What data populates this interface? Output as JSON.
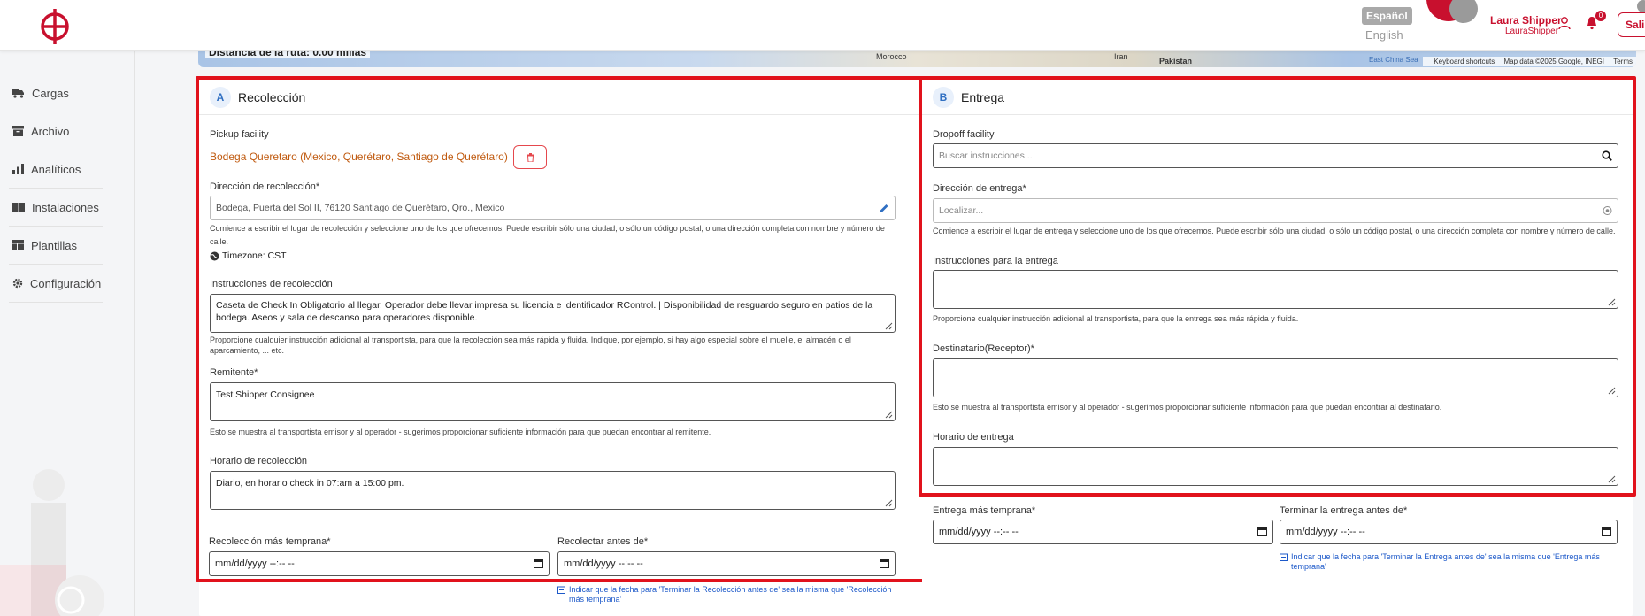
{
  "header": {
    "lang_active": "Español",
    "lang_other": "English",
    "user_name": "Laura Shipper",
    "user_handle": "LauraShipper",
    "notifications": "0",
    "logout_label": "Salir"
  },
  "sidebar": {
    "items": [
      {
        "label": "Cargas",
        "icon": "truck-icon"
      },
      {
        "label": "Archivo",
        "icon": "archive-icon"
      },
      {
        "label": "Analíticos",
        "icon": "bar-chart-icon"
      },
      {
        "label": "Instalaciones",
        "icon": "warehouse-icon"
      },
      {
        "label": "Plantillas",
        "icon": "template-icon"
      },
      {
        "label": "Configuración",
        "icon": "gear-icon"
      }
    ]
  },
  "map": {
    "distance": "Distancia de la ruta: 0.00 millas",
    "labels": [
      "Morocco",
      "Iran",
      "Pakistan",
      "East China Sea"
    ],
    "attr_shortcuts": "Keyboard shortcuts",
    "attr_data": "Map data ©2025 Google, INEGI",
    "attr_terms": "Terms"
  },
  "pickup": {
    "letter": "A",
    "title": "Recolección",
    "facility_label": "Pickup facility",
    "facility_value": "Bodega Queretaro (Mexico, Querétaro, Santiago de Querétaro)",
    "address_label": "Dirección de recolección*",
    "address_value": "Bodega, Puerta del Sol II, 76120 Santiago de Querétaro, Qro., Mexico",
    "address_help": "Comience a escribir el lugar de recolección y seleccione uno de los que ofrecemos. Puede escribir sólo una ciudad, o sólo un código postal, o una dirección completa con nombre y número de calle.",
    "timezone": "Timezone: CST",
    "instructions_label": "Instrucciones de recolección",
    "instructions_value": "Caseta de Check In Obligatorio al llegar. Operador debe llevar impresa su licencia e identificador RControl. | Disponibilidad de resguardo seguro en patios de la bodega. Aseos y sala de descanso para operadores disponible.",
    "instructions_help": "Proporcione cualquier instrucción adicional al transportista, para que la recolección sea más rápida y fluida. Indique, por ejemplo, si hay algo especial sobre el muelle, el almacén o el aparcamiento, ... etc.",
    "sender_label": "Remitente*",
    "sender_value": "Test Shipper Consignee",
    "sender_help": "Esto se muestra al transportista emisor y al operador - sugerimos proporcionar suficiente información para que puedan encontrar al remitente.",
    "hours_label": "Horario de recolección",
    "hours_value": "Diario, en horario check in 07:am a 15:00 pm.",
    "earliest_label": "Recolección más temprana*",
    "earliest_value": "mm/dd/yyyy --:-- --",
    "latest_label": "Recolectar antes de*",
    "latest_value": "mm/dd/yyyy --:-- --",
    "same_date_note": "Indicar que la fecha para 'Terminar la Recolección antes de' sea la misma que 'Recolección más temprana'"
  },
  "delivery": {
    "letter": "B",
    "title": "Entrega",
    "facility_label": "Dropoff facility",
    "facility_placeholder": "Buscar instrucciones...",
    "address_label": "Dirección de entrega*",
    "address_placeholder": "Localizar...",
    "address_help": "Comience a escribir el lugar de entrega y seleccione uno de los que ofrecemos. Puede escribir sólo una ciudad, o sólo un código postal, o una dirección completa con nombre y número de calle.",
    "instructions_label": "Instrucciones para la entrega",
    "instructions_help": "Proporcione cualquier instrucción adicional al transportista, para que la entrega sea más rápida y fluida.",
    "receiver_label": "Destinatario(Receptor)*",
    "receiver_help": "Esto se muestra al transportista emisor y al operador - sugerimos proporcionar suficiente información para que puedan encontrar al destinatario.",
    "hours_label": "Horario de entrega",
    "earliest_label": "Entrega más temprana*",
    "earliest_value": "mm/dd/yyyy --:-- --",
    "latest_label": "Terminar la entrega antes de*",
    "latest_value": "mm/dd/yyyy --:-- --",
    "same_date_note": "Indicar que la fecha para 'Terminar la Entrega antes de' sea la misma que 'Entrega más temprana'"
  },
  "colors": {
    "brand": "#c8102e",
    "highlight": "#e1121c",
    "link": "#1d59c9",
    "facility": "#c05a0f"
  }
}
